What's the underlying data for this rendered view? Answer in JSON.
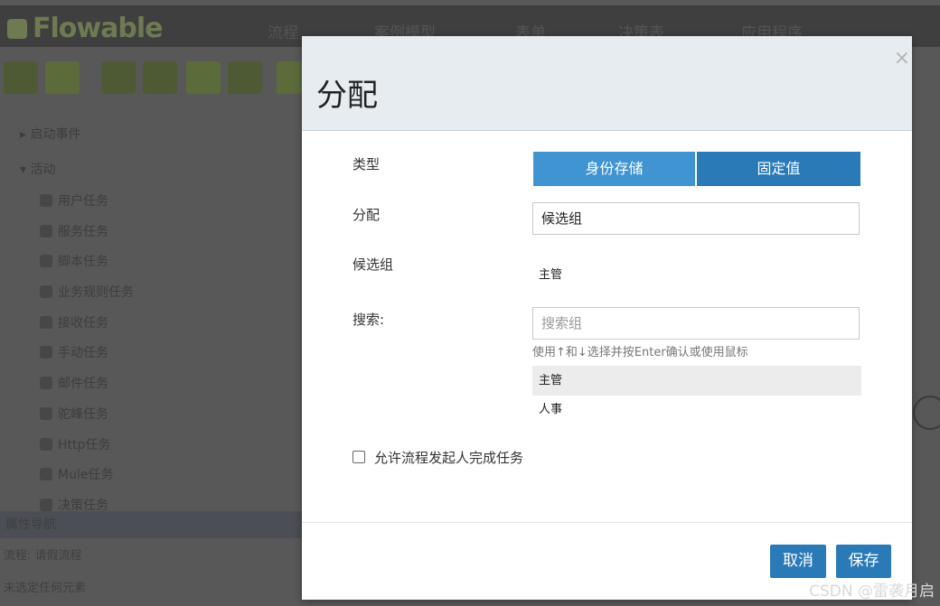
{
  "app": {
    "logo_text": "Flowable",
    "nav": [
      "流程",
      "案例模型",
      "表单",
      "决策表",
      "应用程序"
    ]
  },
  "palette": {
    "groups": [
      {
        "label": "启动事件"
      },
      {
        "label": "活动"
      }
    ],
    "items": [
      "用户任务",
      "服务任务",
      "脚本任务",
      "业务规则任务",
      "接收任务",
      "手动任务",
      "邮件任务",
      "驼峰任务",
      "Http任务",
      "Mule任务",
      "决策任务"
    ]
  },
  "properties": {
    "bar_label": "属性导航",
    "process_line": "流程: 请假流程",
    "selected_line": "未选定任何元素"
  },
  "modal": {
    "title": "分配",
    "close_glyph": "×",
    "type_label": "类型",
    "type_options": {
      "active": "身份存储",
      "inactive": "固定值"
    },
    "assign_label": "分配",
    "assign_value": "候选组",
    "candidate_label": "候选组",
    "candidate_value": "主管",
    "search_label": "搜索:",
    "search_placeholder": "搜索组",
    "search_hint": "使用↑和↓选择并按Enter确认或使用鼠标",
    "results": [
      "主管",
      "人事"
    ],
    "checkbox_label": "允许流程发起人完成任务",
    "cancel_label": "取消",
    "save_label": "保存"
  },
  "watermark": "CSDN @雷袭月启"
}
